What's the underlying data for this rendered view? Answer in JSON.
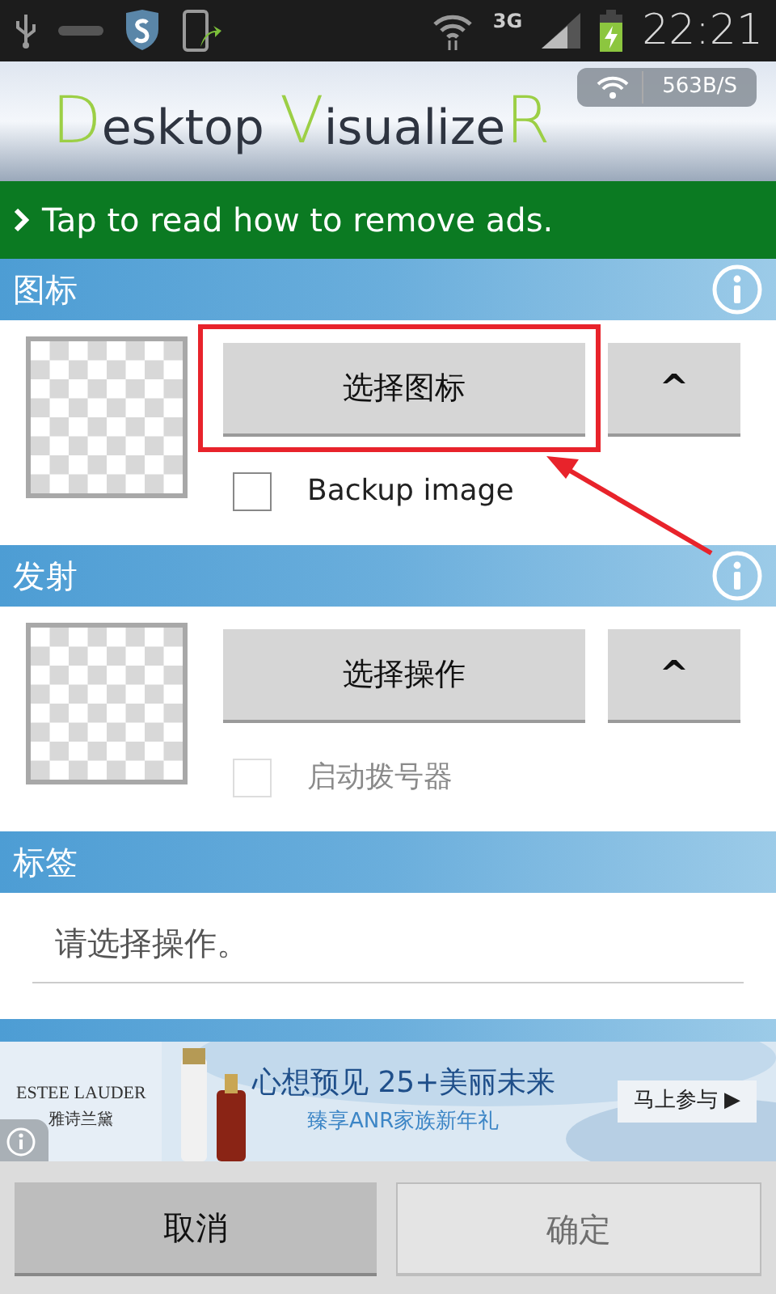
{
  "status_bar": {
    "network": "3G",
    "time": "22:21"
  },
  "header": {
    "logo": [
      {
        "text": "D",
        "accent": true
      },
      {
        "text": "esktop ",
        "accent": false
      },
      {
        "text": "V",
        "accent": true
      },
      {
        "text": "isualize",
        "accent": false
      },
      {
        "text": "R",
        "accent": true
      }
    ],
    "speed": "563B/S"
  },
  "banner": {
    "text": "Tap to read how to remove ads."
  },
  "sections": [
    {
      "title": "图标",
      "button": "选择图标",
      "up": "^",
      "checkbox": {
        "label": "Backup image",
        "checked": false,
        "disabled": false
      }
    },
    {
      "title": "发射",
      "button": "选择操作",
      "up": "^",
      "checkbox": {
        "label": "启动拨号器",
        "checked": false,
        "disabled": true
      }
    },
    {
      "title": "标签",
      "kind": "text",
      "value": "请选择操作。"
    },
    {
      "kind": "cut"
    }
  ],
  "ad": {
    "brand": "ESTEE LAUDER",
    "brand_cn": "雅诗兰黛",
    "headline": "心想预见 25+美丽未来",
    "subline": "臻享ANR家族新年礼",
    "cta": "马上参与 ▶"
  },
  "buttons": [
    {
      "label": "取消",
      "disabled": false
    },
    {
      "label": "确定",
      "disabled": true
    }
  ]
}
